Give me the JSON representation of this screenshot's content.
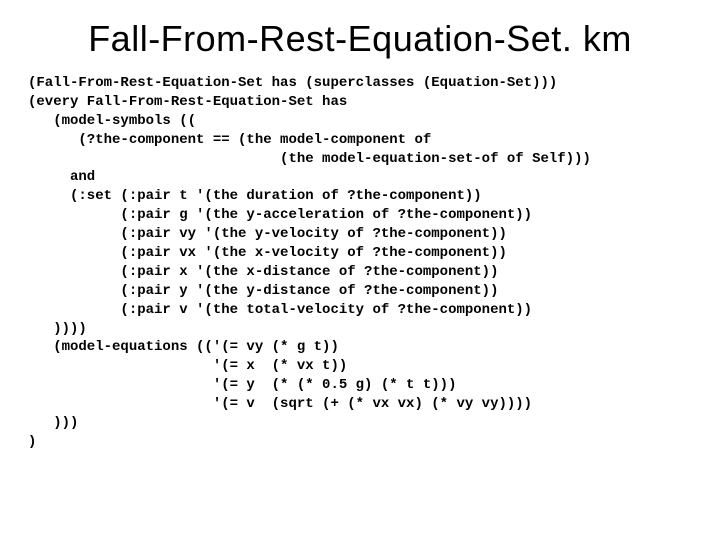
{
  "title": "Fall-From-Rest-Equation-Set. km",
  "code": "(Fall-From-Rest-Equation-Set has (superclasses (Equation-Set)))\n(every Fall-From-Rest-Equation-Set has\n   (model-symbols ((\n      (?the-component == (the model-component of\n                              (the model-equation-set-of of Self)))\n     and\n     (:set (:pair t '(the duration of ?the-component))\n           (:pair g '(the y-acceleration of ?the-component))\n           (:pair vy '(the y-velocity of ?the-component))\n           (:pair vx '(the x-velocity of ?the-component))\n           (:pair x '(the x-distance of ?the-component))\n           (:pair y '(the y-distance of ?the-component))\n           (:pair v '(the total-velocity of ?the-component))\n   ))))\n   (model-equations (('(= vy (* g t))\n                      '(= x  (* vx t))\n                      '(= y  (* (* 0.5 g) (* t t)))\n                      '(= v  (sqrt (+ (* vx vx) (* vy vy))))\n   )))\n)"
}
